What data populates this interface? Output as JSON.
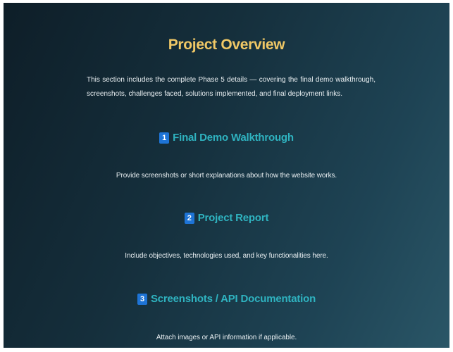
{
  "page": {
    "title": "Project Overview",
    "intro": "This section includes the complete Phase 5 details — covering the final demo walkthrough, screenshots, challenges faced, solutions implemented, and final deployment links."
  },
  "sections": [
    {
      "number": "1",
      "heading": "Final Demo Walkthrough",
      "description": "Provide screenshots or short explanations about how the website works."
    },
    {
      "number": "2",
      "heading": "Project Report",
      "description": "Include objectives, technologies used, and key functionalities here."
    },
    {
      "number": "3",
      "heading": "Screenshots / API Documentation",
      "description": "Attach images or API information if applicable."
    }
  ],
  "colors": {
    "title": "#f0c866",
    "heading": "#2fb3c0",
    "badge": "#1e74d6",
    "text": "#e8eef1"
  }
}
